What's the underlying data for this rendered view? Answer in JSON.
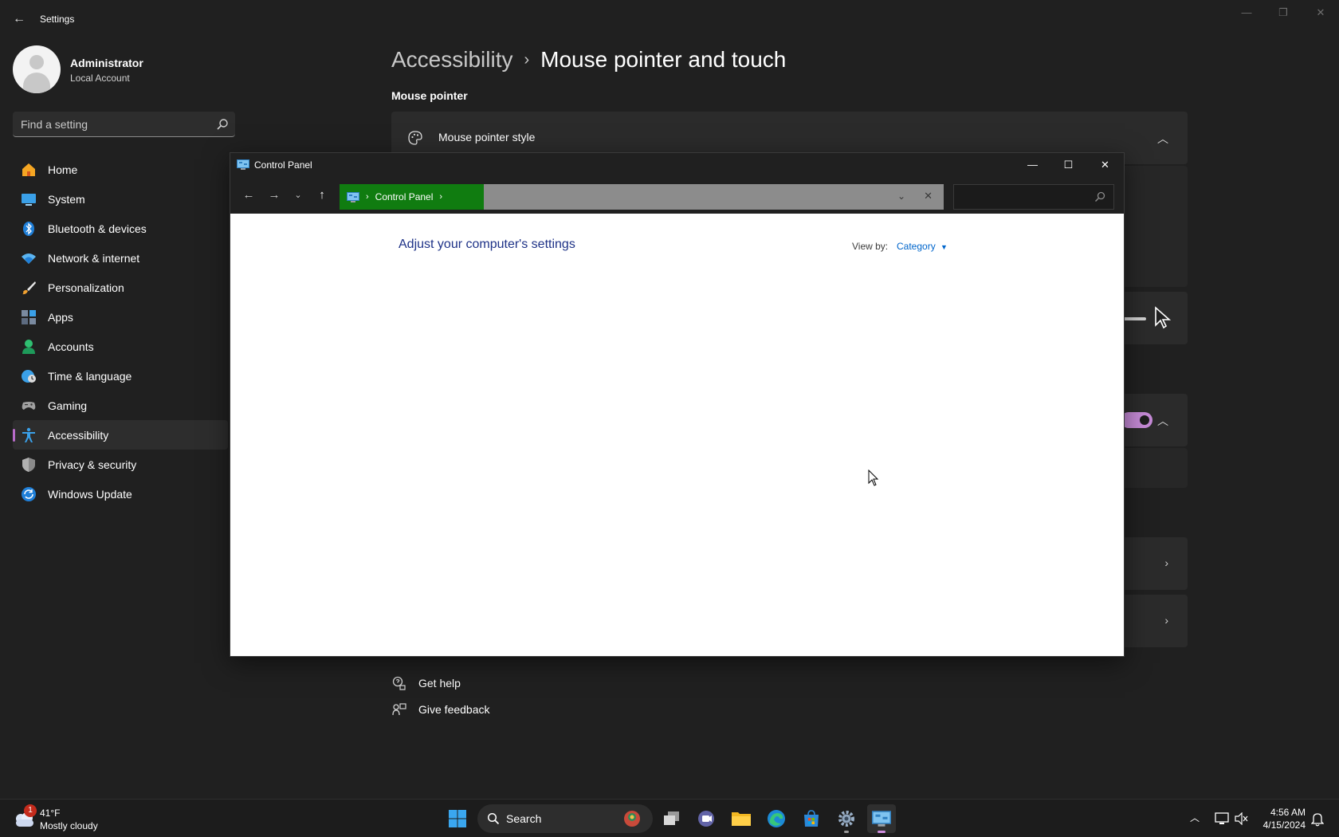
{
  "window": {
    "app_title": "Settings"
  },
  "profile": {
    "name": "Administrator",
    "account_type": "Local Account"
  },
  "search": {
    "placeholder": "Find a setting"
  },
  "nav": {
    "items": [
      {
        "label": "Home",
        "icon": "home-icon"
      },
      {
        "label": "System",
        "icon": "system-icon"
      },
      {
        "label": "Bluetooth & devices",
        "icon": "bluetooth-icon"
      },
      {
        "label": "Network & internet",
        "icon": "network-icon"
      },
      {
        "label": "Personalization",
        "icon": "brush-icon"
      },
      {
        "label": "Apps",
        "icon": "apps-icon"
      },
      {
        "label": "Accounts",
        "icon": "accounts-icon"
      },
      {
        "label": "Time & language",
        "icon": "globe-clock-icon"
      },
      {
        "label": "Gaming",
        "icon": "gamepad-icon"
      },
      {
        "label": "Accessibility",
        "icon": "accessibility-icon",
        "active": true
      },
      {
        "label": "Privacy & security",
        "icon": "shield-icon"
      },
      {
        "label": "Windows Update",
        "icon": "update-icon"
      }
    ]
  },
  "content": {
    "breadcrumb_parent": "Accessibility",
    "breadcrumb_current": "Mouse pointer and touch",
    "section_title": "Mouse pointer",
    "pointer_style_label": "Mouse pointer style",
    "help_label": "Get help",
    "feedback_label": "Give feedback"
  },
  "control_panel": {
    "title": "Control Panel",
    "address_crumb": "Control Panel",
    "search_placeholder": "",
    "heading": "Adjust your computer's settings",
    "view_by_label": "View by:",
    "view_by_value": "Category"
  },
  "taskbar": {
    "weather_badge": "1",
    "weather_temp": "41°F",
    "weather_condition": "Mostly cloudy",
    "search_label": "Search",
    "time": "4:56 AM",
    "date": "4/15/2024"
  },
  "colors": {
    "accent": "#b76bc9",
    "address_crumb_bg": "#107c10",
    "link": "#0066cc",
    "heading": "#1e3287"
  }
}
